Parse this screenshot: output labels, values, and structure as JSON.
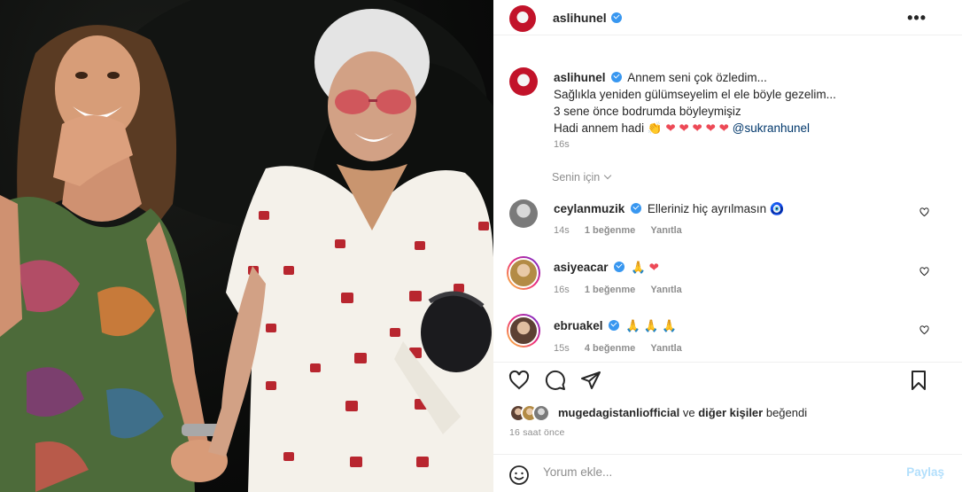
{
  "post": {
    "username": "aslihunel",
    "caption_lines": [
      "Annem seni çok özledim...",
      "Sağlıkla yeniden gülümseyelim el ele böyle gezelim...",
      "3 sene önce bodrumda böyleymişiz",
      "Hadi annem hadi"
    ],
    "caption_mention": "@sukranhunel",
    "caption_time": "16s",
    "sort_label": "Senin için"
  },
  "comments": [
    {
      "username": "ceylanmuzik",
      "text": "Elleriniz hiç ayrılmasın",
      "time": "14s",
      "likes": "1 beğenme",
      "reply": "Yanıtla"
    },
    {
      "username": "asiyeacar",
      "text": "",
      "time": "16s",
      "likes": "1 beğenme",
      "reply": "Yanıtla"
    },
    {
      "username": "ebruakel",
      "text": "",
      "time": "15s",
      "likes": "4 beğenme",
      "reply": "Yanıtla"
    }
  ],
  "likes": {
    "first_user": "mugedagistanliofficial",
    "connector": "ve",
    "others": "diğer kişiler",
    "suffix": "beğendi"
  },
  "time_ago": "16 saat önce",
  "comment_box": {
    "placeholder": "Yorum ekle...",
    "post_label": "Paylaş"
  },
  "icons": [
    "more-icon",
    "heart-icon",
    "comment-icon",
    "share-icon",
    "bookmark-icon",
    "emoji-icon",
    "verified-badge-icon"
  ],
  "colors": {
    "verified": "#3897f0",
    "heart": "#ed4956",
    "mention": "#00376b",
    "muted": "#8e8e8e",
    "post_disabled": "#b2dffc"
  }
}
